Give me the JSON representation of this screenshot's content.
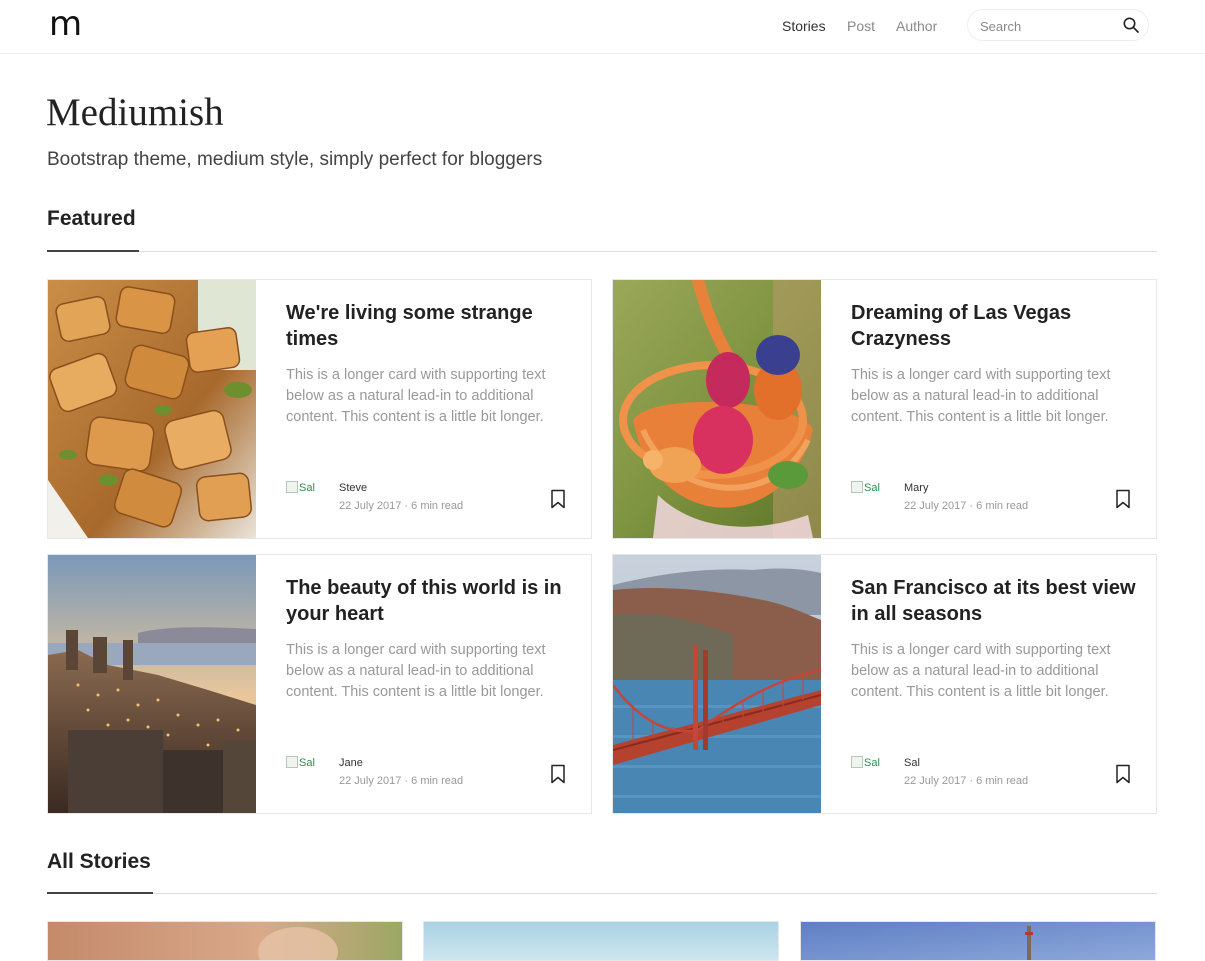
{
  "nav": {
    "logo": "m",
    "links": [
      "Stories",
      "Post",
      "Author"
    ],
    "search_placeholder": "Search"
  },
  "header": {
    "title": "Mediumish",
    "description": "Bootstrap theme, medium style, simply perfect for bloggers"
  },
  "sections": {
    "featured": "Featured",
    "all_stories": "All Stories"
  },
  "featured_cards": [
    {
      "title": "We're living some strange times",
      "text": "This is a longer card with supporting text below as a natural lead-in to additional content. This content is a little bit longer.",
      "avatar_alt": "Sal",
      "author": "Steve",
      "meta": "22 July 2017 · 6 min read",
      "image": "chicken-salad"
    },
    {
      "title": "Dreaming of Las Vegas Crazyness",
      "text": "This is a longer card with supporting text below as a natural lead-in to additional content. This content is a little bit longer.",
      "avatar_alt": "Sal",
      "author": "Mary",
      "meta": "22 July 2017 · 6 min read",
      "image": "easter-basket"
    },
    {
      "title": "The beauty of this world is in your heart",
      "text": "This is a longer card with supporting text below as a natural lead-in to additional content. This content is a little bit longer.",
      "avatar_alt": "Sal",
      "author": "Jane",
      "meta": "22 July 2017 · 6 min read",
      "image": "city-sunset"
    },
    {
      "title": "San Francisco at its best view in all seasons",
      "text": "This is a longer card with supporting text below as a natural lead-in to additional content. This content is a little bit longer.",
      "avatar_alt": "Sal",
      "author": "Sal",
      "meta": "22 July 2017 · 6 min read",
      "image": "golden-gate-bridge"
    }
  ],
  "colors": {
    "text_dark": "#222222",
    "text_muted": "#999999",
    "nav_active": "#333333",
    "nav_inactive": "#8a8a8a",
    "avatar_alt_text": "#2c8f4e",
    "border": "#e7e7e7"
  },
  "icons": {
    "search": "search-icon",
    "bookmark": "bookmark-icon"
  }
}
